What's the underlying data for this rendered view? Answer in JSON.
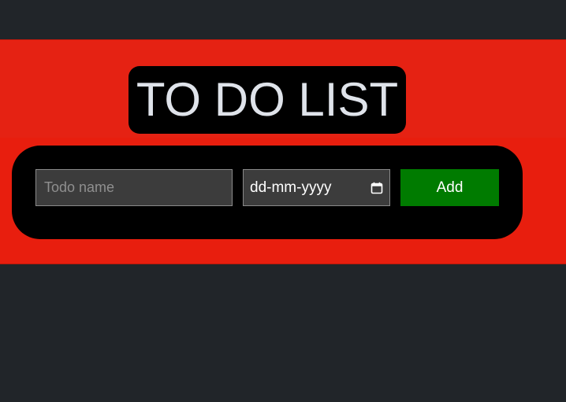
{
  "header": {
    "title": "TO DO LIST"
  },
  "form": {
    "todo_placeholder": "Todo name",
    "todo_value": "",
    "date_placeholder": "dd-mm-yyyy",
    "add_label": "Add"
  },
  "icons": {
    "date_picker": "calendar-icon"
  },
  "colors": {
    "page_background": "#212529",
    "band": "#e52213",
    "panel": "#000000",
    "title_text": "#dfe3ea",
    "input_background": "#3c3c3c",
    "add_button": "#007b00"
  }
}
